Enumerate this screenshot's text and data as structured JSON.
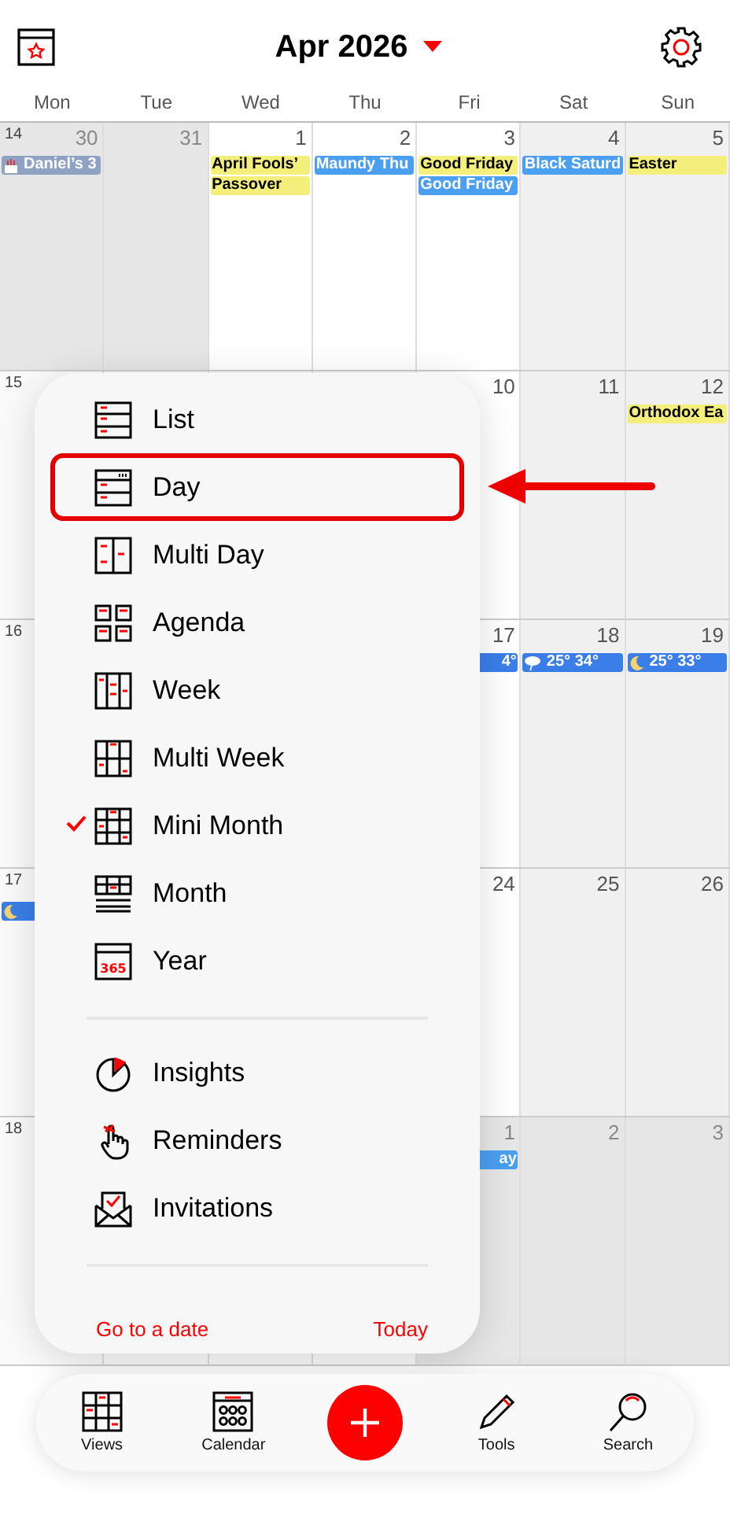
{
  "header": {
    "title": "Apr 2026"
  },
  "weekdays": [
    "Mon",
    "Tue",
    "Wed",
    "Thu",
    "Fri",
    "Sat",
    "Sun"
  ],
  "weeks": [
    {
      "number": "14",
      "days": [
        {
          "day": "30",
          "out": true,
          "events": [
            {
              "kind": "birthday",
              "text": "Daniel’s 3"
            }
          ]
        },
        {
          "day": "31",
          "out": true
        },
        {
          "day": "1",
          "out": false,
          "events": [
            {
              "kind": "holiday",
              "text": "April Fools’"
            },
            {
              "kind": "holiday",
              "text": "Passover"
            }
          ]
        },
        {
          "day": "2",
          "out": false,
          "events": [
            {
              "kind": "observance",
              "text": "Maundy Thu"
            }
          ]
        },
        {
          "day": "3",
          "out": false,
          "events": [
            {
              "kind": "holiday",
              "text": "Good Friday"
            },
            {
              "kind": "observance",
              "text": "Good Friday"
            }
          ]
        },
        {
          "day": "4",
          "out": false,
          "events": [
            {
              "kind": "observance",
              "text": "Black Saturd"
            }
          ]
        },
        {
          "day": "5",
          "out": false,
          "events": [
            {
              "kind": "holiday",
              "text": "Easter"
            }
          ]
        }
      ]
    },
    {
      "number": "15",
      "days": [
        {
          "day": "10",
          "out": false
        },
        {
          "day": "11",
          "out": false
        },
        {
          "day": "12",
          "out": false,
          "events": [
            {
              "kind": "holiday",
              "text": "Orthodox Ea"
            }
          ]
        }
      ]
    },
    {
      "number": "16",
      "days": [
        {
          "day": "17",
          "out": false,
          "events": [
            {
              "kind": "weather",
              "text": "4°",
              "clipped": true
            }
          ]
        },
        {
          "day": "18",
          "out": false,
          "events": [
            {
              "kind": "rain",
              "text": "25° 34°",
              "clipped": false
            }
          ]
        },
        {
          "day": "19",
          "out": false,
          "events": [
            {
              "kind": "night",
              "text": "25° 33°",
              "clipped": false
            }
          ]
        }
      ]
    },
    {
      "number": "17",
      "leading_events": [
        {
          "kind": "night"
        }
      ],
      "days": [
        {
          "day": "24",
          "out": false
        },
        {
          "day": "25",
          "out": false
        },
        {
          "day": "26",
          "out": false
        }
      ]
    },
    {
      "number": "18",
      "days": [
        {
          "day": "1",
          "out": true,
          "events": [
            {
              "kind": "observance",
              "text": "ay",
              "clipped": true
            }
          ]
        },
        {
          "day": "2",
          "out": true
        },
        {
          "day": "3",
          "out": true
        }
      ]
    }
  ],
  "menu": {
    "views": [
      {
        "label": "List",
        "selected": false,
        "highlighted": false
      },
      {
        "label": "Day",
        "selected": false,
        "highlighted": true
      },
      {
        "label": "Multi Day",
        "selected": false,
        "highlighted": false
      },
      {
        "label": "Agenda",
        "selected": false,
        "highlighted": false
      },
      {
        "label": "Week",
        "selected": false,
        "highlighted": false
      },
      {
        "label": "Multi Week",
        "selected": false,
        "highlighted": false
      },
      {
        "label": "Mini Month",
        "selected": true,
        "highlighted": false
      },
      {
        "label": "Month",
        "selected": false,
        "highlighted": false
      },
      {
        "label": "Year",
        "selected": false,
        "highlighted": false,
        "icon_text": "365"
      }
    ],
    "tools": [
      {
        "label": "Insights"
      },
      {
        "label": "Reminders"
      },
      {
        "label": "Invitations"
      }
    ],
    "footer": {
      "left": "Go to a date",
      "right": "Today"
    }
  },
  "tab_bar": [
    {
      "kind": "tab",
      "label": "Views"
    },
    {
      "kind": "tab",
      "label": "Calendar"
    },
    {
      "kind": "add"
    },
    {
      "kind": "tab",
      "label": "Tools"
    },
    {
      "kind": "tab",
      "label": "Search"
    }
  ]
}
